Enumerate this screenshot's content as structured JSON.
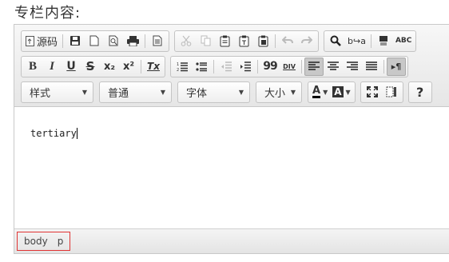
{
  "page": {
    "label": "专栏内容:"
  },
  "toolbar": {
    "source_label": "源码",
    "format_label": "样式",
    "paragraph_label": "普通",
    "font_label": "字体",
    "size_label": "大小",
    "text_color_glyph": "A",
    "bg_color_glyph": "A",
    "help_glyph": "?",
    "blockquote_glyph": "99",
    "div_glyph": "DIV",
    "spellcheck_glyph": "ABC",
    "superscript_glyph": "x²",
    "subscript_glyph": "x₂",
    "bold_glyph": "B",
    "italic_glyph": "I",
    "underline_glyph": "U",
    "strike_glyph": "S",
    "removeformat_glyph": "Tx"
  },
  "editor": {
    "content": "tertiary"
  },
  "status": {
    "path": [
      "body",
      "p"
    ]
  }
}
